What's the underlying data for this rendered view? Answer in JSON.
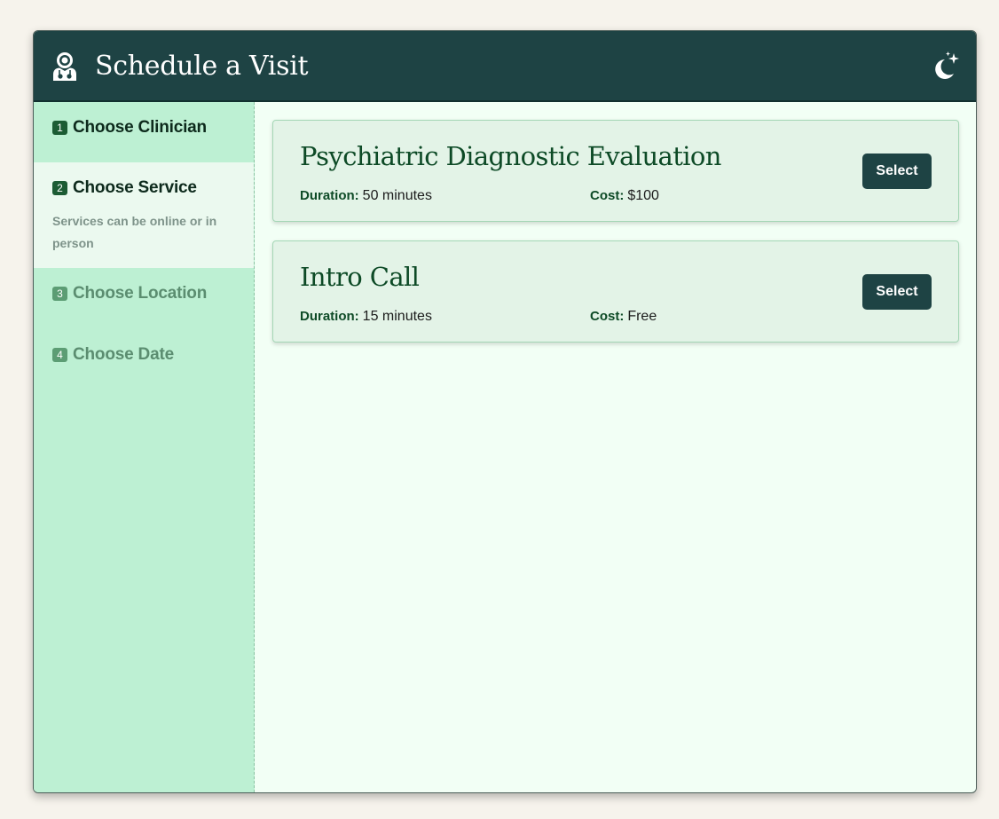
{
  "header": {
    "title": "Schedule a Visit",
    "icon": "clinician-icon",
    "theme_toggle_icon": "moon-stars-icon"
  },
  "steps": [
    {
      "number": "1",
      "label": "Choose Clinician",
      "state": "done"
    },
    {
      "number": "2",
      "label": "Choose Service",
      "state": "active",
      "description": "Services can be online or in person"
    },
    {
      "number": "3",
      "label": "Choose Location",
      "state": "pending"
    },
    {
      "number": "4",
      "label": "Choose Date",
      "state": "pending"
    }
  ],
  "services": [
    {
      "name": "Psychiatric Diagnostic Evaluation",
      "duration_label": "Duration:",
      "duration_value": "50 minutes",
      "cost_label": "Cost:",
      "cost_value": "$100",
      "button_label": "Select"
    },
    {
      "name": "Intro Call",
      "duration_label": "Duration:",
      "duration_value": "15 minutes",
      "cost_label": "Cost:",
      "cost_value": "Free",
      "button_label": "Select"
    }
  ],
  "colors": {
    "page_background": "#f6f3ec",
    "header": "#1e4344",
    "sidebar": "#bdf0d3",
    "active_step": "#ebf9ef",
    "content": "#f2fff5",
    "card": "#e3f3e7",
    "accent_text": "#0d4a26",
    "button": "#1e4344"
  }
}
